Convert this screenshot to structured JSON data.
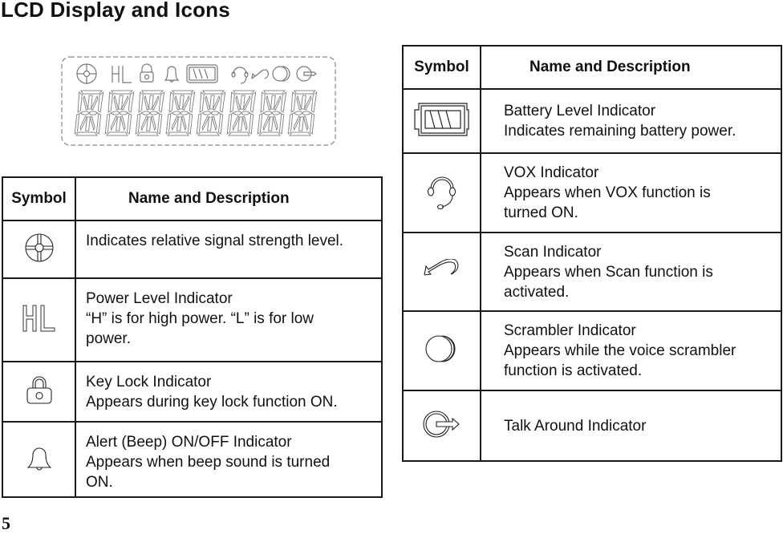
{
  "title": "LCD Display and Icons",
  "page_number": "5",
  "lcd_display": {
    "icons": [
      "signal-icon",
      "power-level-icon",
      "key-lock-icon",
      "bell-icon",
      "battery-icon",
      "vox-headset-icon",
      "scan-icon",
      "scrambler-icon",
      "talk-around-icon"
    ],
    "segment_digits": 8
  },
  "table_left": {
    "headers": {
      "symbol": "Symbol",
      "description": "Name and Description"
    },
    "rows": [
      {
        "icon": "signal-strength-icon",
        "lines": [
          "Indicates relative signal strength level."
        ]
      },
      {
        "icon": "power-level-icon",
        "lines": [
          "Power Level Indicator",
          "“H” is for high power. “L” is for low",
          "power."
        ]
      },
      {
        "icon": "key-lock-icon",
        "lines": [
          "Key Lock Indicator",
          "Appears during key lock function ON."
        ]
      },
      {
        "icon": "bell-icon",
        "lines": [
          "Alert (Beep) ON/OFF Indicator",
          "Appears when beep sound is turned",
          "ON."
        ]
      }
    ]
  },
  "table_right": {
    "headers": {
      "symbol": "Symbol",
      "description": "Name and Description"
    },
    "rows": [
      {
        "icon": "battery-icon",
        "lines": [
          "Battery Level Indicator",
          "Indicates remaining battery power."
        ]
      },
      {
        "icon": "vox-headset-icon",
        "lines": [
          "VOX Indicator",
          "Appears when VOX function is",
          "turned ON."
        ]
      },
      {
        "icon": "scan-icon",
        "lines": [
          "Scan Indicator",
          "Appears when Scan function is",
          "activated."
        ]
      },
      {
        "icon": "scrambler-icon",
        "lines": [
          "Scrambler Indicator",
          "Appears while the voice scrambler",
          "function is activated."
        ]
      },
      {
        "icon": "talk-around-icon",
        "lines": [
          "Talk Around Indicator"
        ]
      }
    ]
  }
}
